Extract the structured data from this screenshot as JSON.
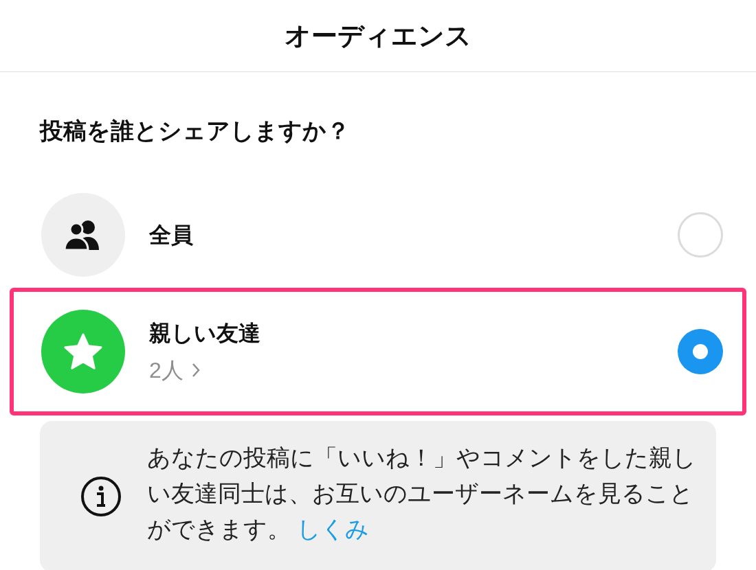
{
  "header": {
    "title": "オーディエンス"
  },
  "question": "投稿を誰とシェアしますか？",
  "options": [
    {
      "kind": "everyone",
      "label": "全員",
      "selected": false,
      "highlighted": false
    },
    {
      "kind": "close_friends",
      "label": "親しい友達",
      "subtitle": "2人",
      "selected": true,
      "highlighted": true
    }
  ],
  "info": {
    "text": "あなたの投稿に「いいね！」やコメントをした親しい友達同士は、お互いのユーザーネームを見ることができます。",
    "link": "しくみ"
  }
}
